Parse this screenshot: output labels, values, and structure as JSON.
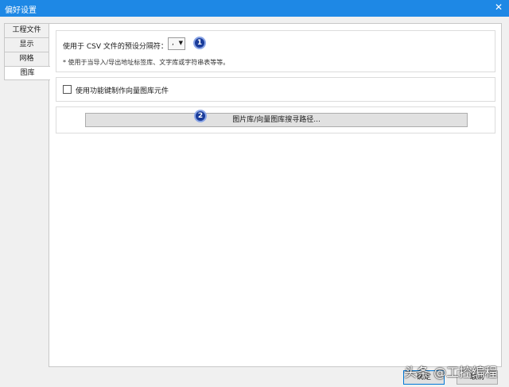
{
  "window": {
    "title": "偏好设置",
    "close_glyph": "✕"
  },
  "tabs": [
    {
      "label": "工程文件"
    },
    {
      "label": "显示"
    },
    {
      "label": "网格"
    },
    {
      "label": "图库"
    }
  ],
  "csv": {
    "label": "使用于 CSV 文件的预设分隔符：",
    "separator_value": ",",
    "note": "* 使用于当导入/导出地址标签库、文字库或字符串表等等。",
    "marker": "1"
  },
  "function_key": {
    "label": "使用功能键制作向量图库元件",
    "checked": false
  },
  "library_path": {
    "button_label": "图片库/向量图库搜寻路径...",
    "marker": "2"
  },
  "footer": {
    "ok_label": "确定",
    "cancel_label": "取消"
  },
  "watermark": {
    "text": "头条 @工控编程"
  },
  "colors": {
    "titlebar": "#1e88e5",
    "marker": "#1a3c9a"
  }
}
